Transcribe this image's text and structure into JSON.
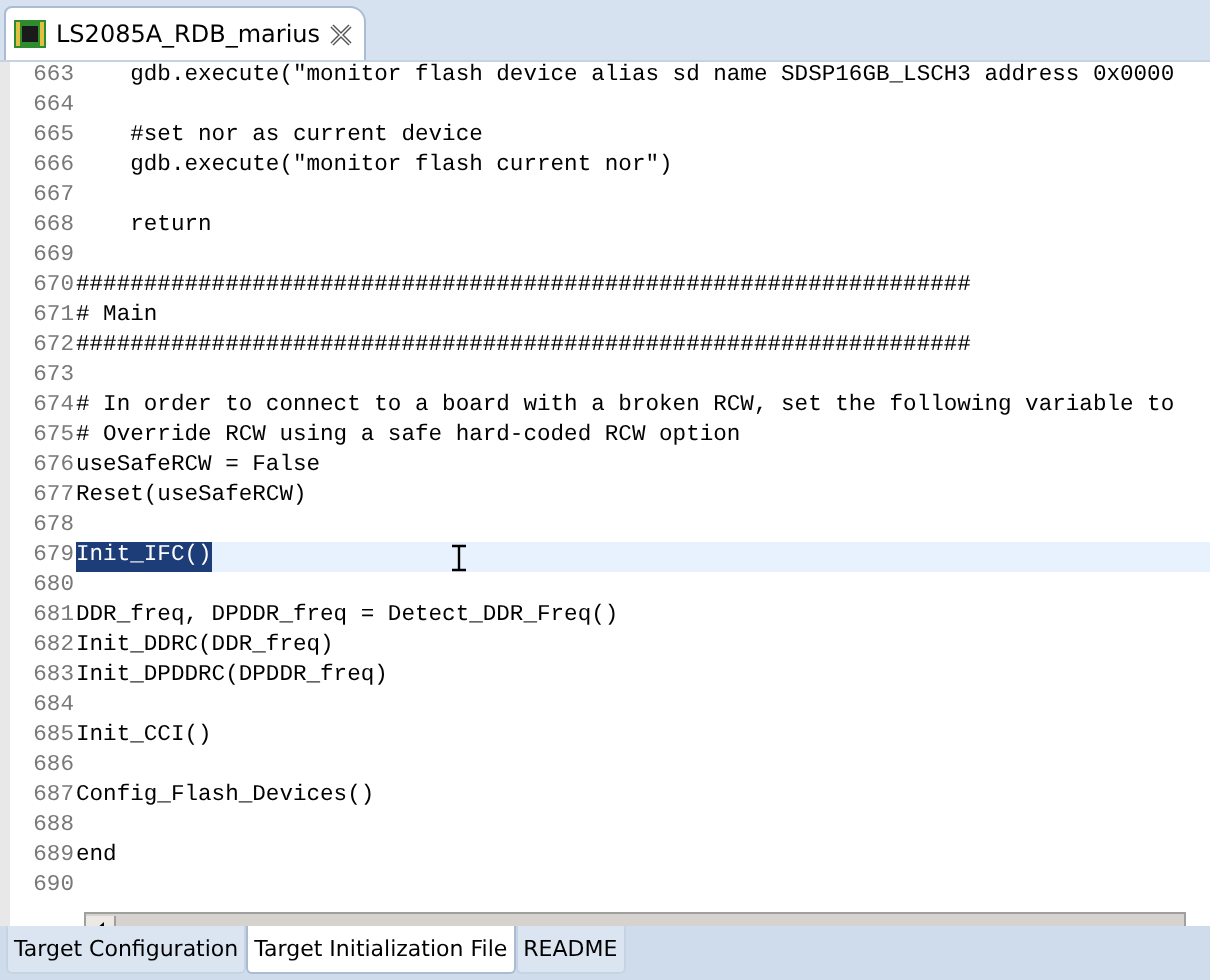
{
  "editor_tab": {
    "title": "LS2085A_RDB_marius",
    "selected": true
  },
  "lines": [
    {
      "number": "663",
      "text": "    gdb.execute(\"monitor flash device alias sd name SDSP16GB_LSCH3 address 0x0000",
      "current": false
    },
    {
      "number": "664",
      "current": false
    },
    {
      "number": "665",
      "text": "    #set nor as current device",
      "current": false
    },
    {
      "number": "666",
      "text": "    gdb.execute(\"monitor flash current nor\")",
      "current": false
    },
    {
      "number": "667",
      "current": false
    },
    {
      "number": "668",
      "text": "    return",
      "current": false
    },
    {
      "number": "669",
      "current": false
    },
    {
      "number": "670",
      "text": "##################################################################",
      "current": false
    },
    {
      "number": "671",
      "text": "# Main",
      "current": false
    },
    {
      "number": "672",
      "text": "##################################################################",
      "current": false
    },
    {
      "number": "673",
      "current": false
    },
    {
      "number": "674",
      "text": "# In order to connect to a board with a broken RCW, set the following variable to",
      "current": false
    },
    {
      "number": "675",
      "text": "# Override RCW using a safe hard-coded RCW option",
      "current": false
    },
    {
      "number": "676",
      "text": "useSafeRCW = False",
      "current": false
    },
    {
      "number": "677",
      "text": "Reset(useSafeRCW)",
      "current": false
    },
    {
      "number": "678",
      "current": false
    },
    {
      "number": "679",
      "text": "Init_IFC()",
      "current": true
    },
    {
      "number": "680",
      "current": false
    },
    {
      "number": "681",
      "text": "DDR_freq, DPDDR_freq = Detect_DDR_Freq()",
      "current": false
    },
    {
      "number": "682",
      "text": "Init_DDRC(DDR_freq)",
      "current": false
    },
    {
      "number": "683",
      "text": "Init_DPDDRC(DPDDR_freq)",
      "current": false
    },
    {
      "number": "684",
      "current": false
    },
    {
      "number": "685",
      "text": "Init_CCI()",
      "current": false
    },
    {
      "number": "686",
      "current": false
    },
    {
      "number": "687",
      "text": "Config_Flash_Devices()",
      "current": false
    },
    {
      "number": "688",
      "current": false
    },
    {
      "number": "689",
      "text": "end",
      "current": false
    },
    {
      "number": "690",
      "current": false
    }
  ],
  "bottom_tabs": [
    {
      "label": "Target Configuration",
      "selected": false
    },
    {
      "label": "Target Initialization File",
      "selected": true
    },
    {
      "label": "README",
      "selected": false
    }
  ]
}
